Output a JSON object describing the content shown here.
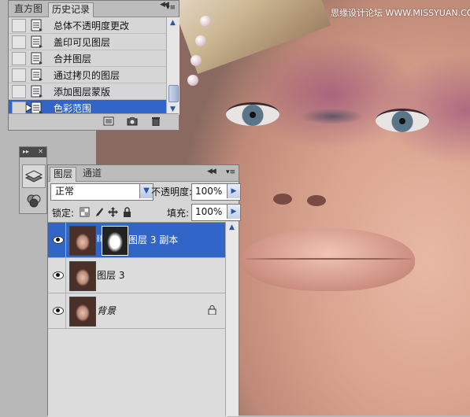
{
  "watermark": "思缘设计论坛 WWW.MISSYUAN.COM",
  "history_panel": {
    "tabs": [
      {
        "label": "直方图",
        "active": false
      },
      {
        "label": "历史记录",
        "active": true
      }
    ],
    "collapse_glyph": "◀◀",
    "menu_glyph": "▾≡",
    "items": [
      {
        "label": "总体不透明度更改",
        "selected": false
      },
      {
        "label": "盖印可见图层",
        "selected": false
      },
      {
        "label": "合并图层",
        "selected": false
      },
      {
        "label": "通过拷贝的图层",
        "selected": false
      },
      {
        "label": "添加图层蒙版",
        "selected": false
      },
      {
        "label": "色彩范围",
        "selected": true
      }
    ],
    "bottom_icons": [
      "new-document-from-state-icon",
      "new-snapshot-icon",
      "delete-icon"
    ]
  },
  "mini_toolbar": {
    "header_glyph": "▸▸",
    "close_glyph": "✕",
    "buttons": [
      "layers-icon",
      "channels-icon"
    ]
  },
  "layers_panel": {
    "tabs": [
      {
        "label": "图层",
        "active": true
      },
      {
        "label": "通道",
        "active": false
      }
    ],
    "collapse_glyph": "◀◀",
    "menu_glyph": "▾≡",
    "blend_mode": "正常",
    "opacity_label": "不透明度:",
    "opacity_value": "100%",
    "lock_label": "锁定:",
    "fill_label": "填充:",
    "fill_value": "100%",
    "layers": [
      {
        "name": "图层 3 副本",
        "selected": true,
        "visible": true,
        "has_mask": true,
        "locked": false,
        "italic": false
      },
      {
        "name": "图层 3",
        "selected": false,
        "visible": true,
        "has_mask": false,
        "locked": false,
        "italic": false
      },
      {
        "name": "背景",
        "selected": false,
        "visible": true,
        "has_mask": false,
        "locked": true,
        "italic": true
      }
    ]
  },
  "colors": {
    "selection_blue": "#3166c8",
    "panel_gray": "#d6d6d6",
    "tabstrip_gray": "#bcbcbc"
  }
}
